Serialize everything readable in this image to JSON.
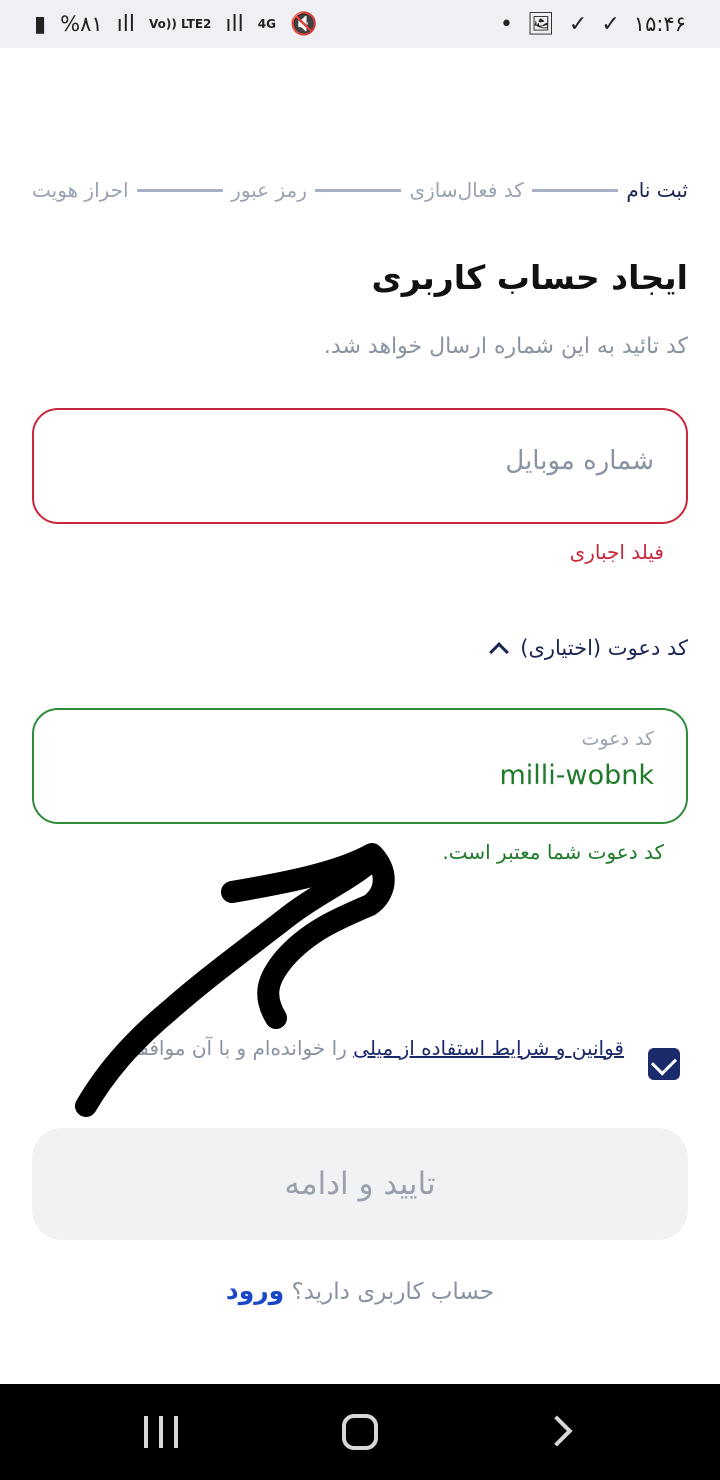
{
  "status_bar": {
    "battery": "%۸۱",
    "volte": "Vo)) LTE2",
    "network": "4G",
    "time": "۱۵:۴۶"
  },
  "stepper": [
    "ثبت نام",
    "کد فعال‌سازی",
    "رمز عبور",
    "احراز هویت"
  ],
  "page_title": "ایجاد حساب کاربری",
  "subtitle": "کد تائید به این شماره ارسال خواهد شد.",
  "phone_field": {
    "placeholder": "شماره موبایل",
    "error": "فیلد اجباری"
  },
  "invite_toggle_label": "کد دعوت (اختیاری)",
  "invite_field": {
    "label": "کد دعوت",
    "value": "milli-wobnk",
    "success": "کد دعوت شما معتبر است."
  },
  "terms": {
    "link": "قوانین و شرایط استفاده از میلی",
    "text": " را خوانده‌ام و با آن موافقم.",
    "checked": true
  },
  "submit_label": "تایید و ادامه",
  "login": {
    "question": "حساب کاربری دارید؟",
    "link": "ورود"
  },
  "colors": {
    "error": "#c8283b",
    "success": "#1f7a2a",
    "primary": "#1b2a6b",
    "link": "#1a47c7"
  }
}
